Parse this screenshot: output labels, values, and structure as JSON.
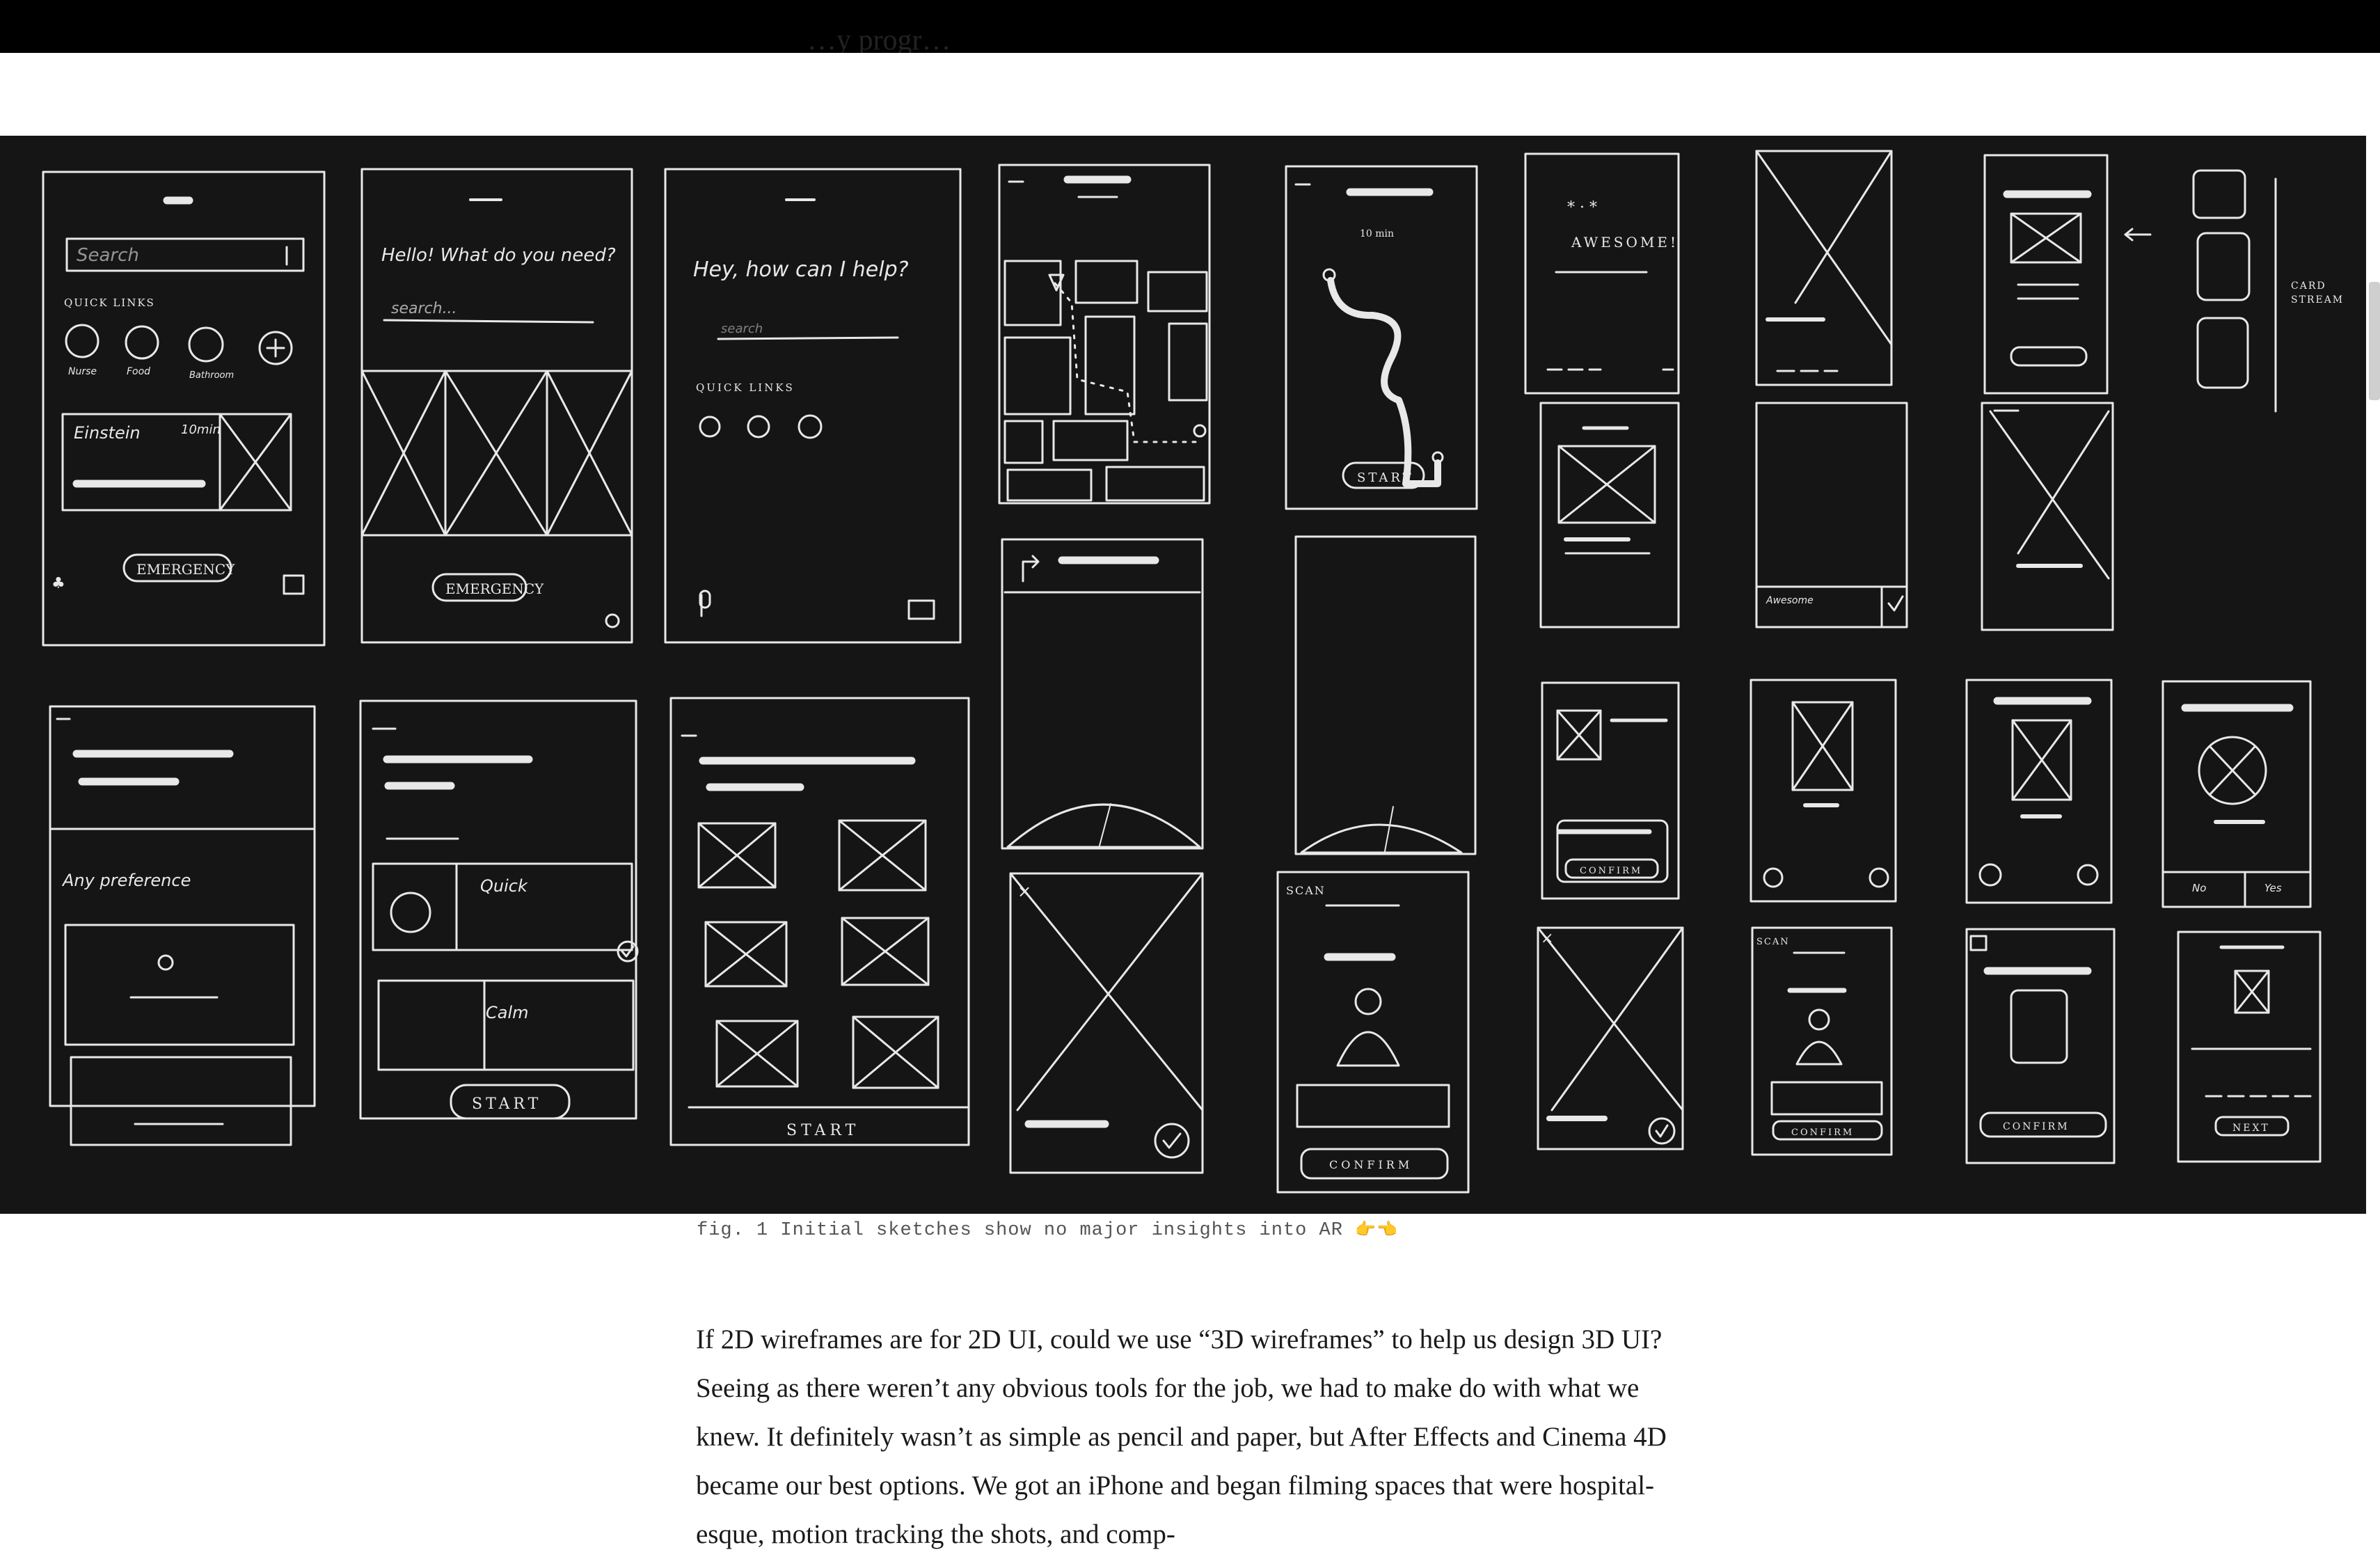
{
  "page": {
    "top_cutoff_text": "…y progr…",
    "figure_alt": "Grid of hand-drawn white-on-black wireframe sketches of mobile screens",
    "caption": "fig. 1 Initial sketches show no major insights into AR",
    "caption_emoji": "👉👈",
    "article_paragraph": "If 2D wireframes are for 2D UI, could we use “3D wireframes” to help us design 3D UI? Seeing as there weren’t any obvious tools for the job, we had to make do with what we knew. It definitely wasn’t as simple as pencil and paper, but After Effects and Cinema 4D became our best options. We got an iPhone and began filming spaces that were hospital-esque, motion tracking the shots, and comp-"
  },
  "sketch_labels": {
    "search": "Search",
    "quick_links": "QUICK LINKS",
    "nurse": "Nurse",
    "food": "Food",
    "bathroom": "Bathroom",
    "add": "Add",
    "einstein": "Einstein",
    "ten_min": "10min",
    "emergency": "EMERGENCY",
    "hello": "Hello! What do you need?",
    "search_dots": "search...",
    "hey_help": "Hey, how can I help?",
    "search_small": "search",
    "start": "START",
    "awesome": "AWESOME!",
    "card_stream": "CARD STREAM",
    "any_preference": "Any preference",
    "quick": "Quick",
    "calm": "Calm",
    "scan": "SCAN",
    "confirm": "CONFIRM",
    "no": "No",
    "yes": "Yes",
    "next": "NEXT",
    "awesome_small": "Awesome",
    "time_small": "10 min"
  },
  "colors": {
    "sketch_bg": "#151515",
    "sketch_line": "#e8e8e8",
    "top_bar": "#000000"
  }
}
